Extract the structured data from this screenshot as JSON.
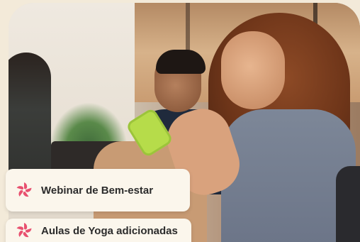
{
  "cards": [
    {
      "label": "Webinar de Bem-estar",
      "icon": "pinwheel-icon"
    },
    {
      "label": "Aulas de Yoga adicionadas",
      "icon": "pinwheel-icon"
    }
  ],
  "colors": {
    "background": "#f3ead9",
    "card_bg": "#fbf6ec",
    "accent": "#e8506f",
    "text": "#2b2b2b"
  }
}
